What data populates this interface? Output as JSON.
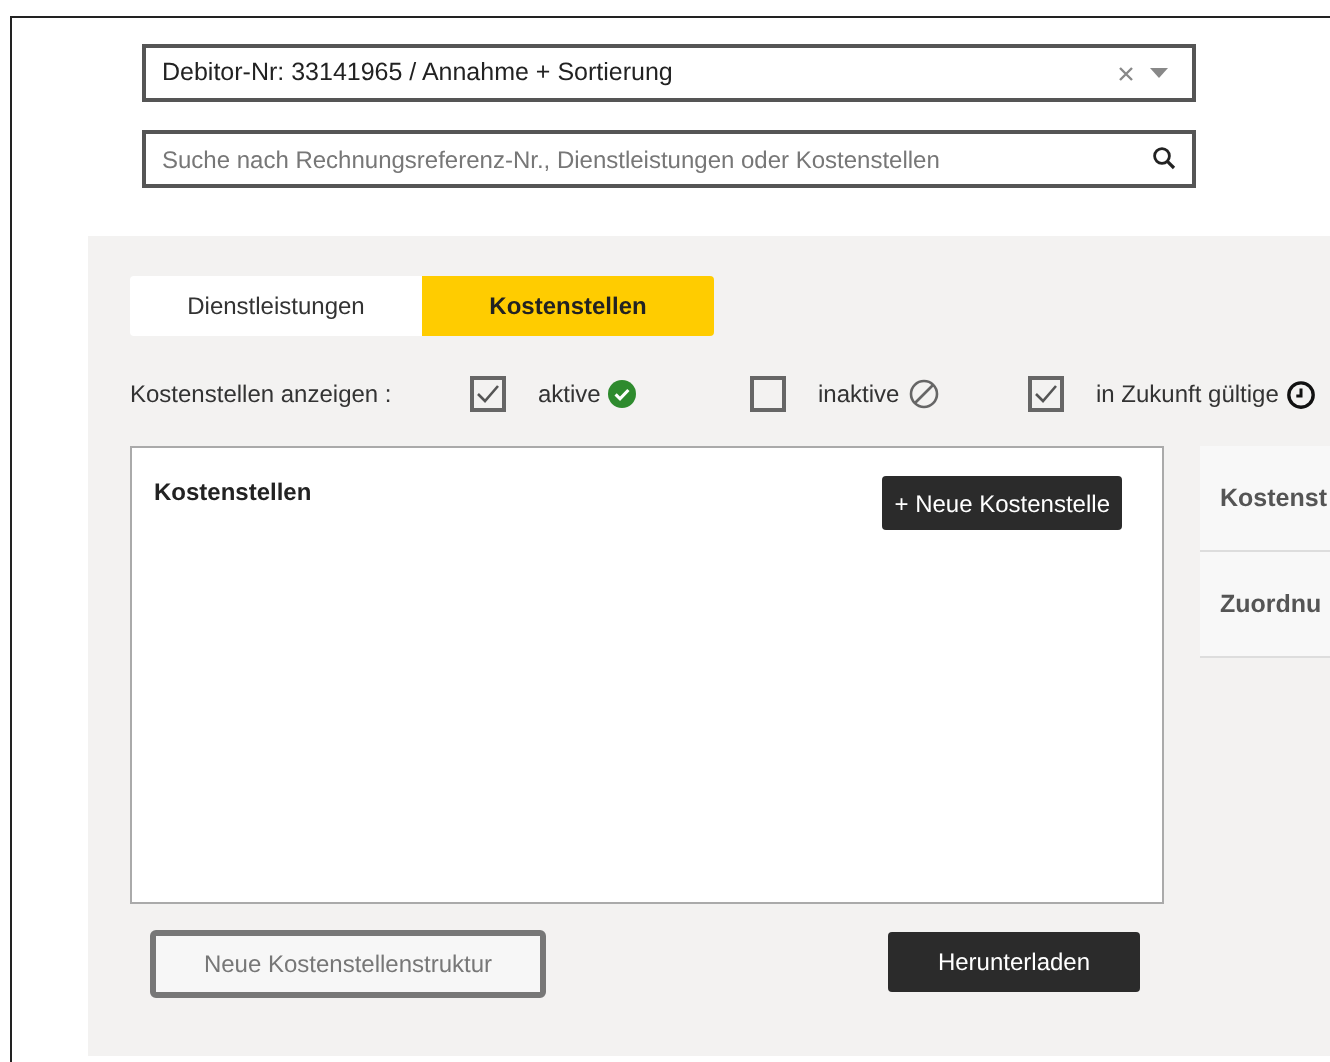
{
  "debtor_select": {
    "value": "Debitor-Nr: 33141965 / Annahme + Sortierung"
  },
  "search": {
    "placeholder": "Suche nach Rechnungsreferenz-Nr., Dienstleistungen oder Kostenstellen"
  },
  "tabs": [
    {
      "label": "Dienstleistungen",
      "selected": false
    },
    {
      "label": "Kostenstellen",
      "selected": true
    }
  ],
  "filter": {
    "label": "Kostenstellen anzeigen :",
    "options": [
      {
        "label": "aktive",
        "checked": true,
        "kind": "active"
      },
      {
        "label": "inaktive",
        "checked": false,
        "kind": "inactive"
      },
      {
        "label": "in Zukunft gültige",
        "checked": true,
        "kind": "future"
      }
    ]
  },
  "cost_centers_panel": {
    "title": "Kostenstellen",
    "add_button": "+ Neue Kostenstelle"
  },
  "side_panel": {
    "rows": [
      "Kostenst",
      "Zuordnu"
    ]
  },
  "buttons": {
    "new_structure": "Neue Kostenstellenstruktur",
    "download": "Herunterladen"
  }
}
